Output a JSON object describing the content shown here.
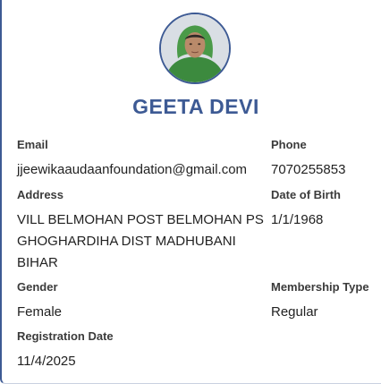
{
  "profile": {
    "name": "GEETA DEVI",
    "avatar_icon": "profile-photo"
  },
  "fields": {
    "email": {
      "label": "Email",
      "value": "jjeewikaaudaanfoundation@gmail.com"
    },
    "phone": {
      "label": "Phone",
      "value": "7070255853"
    },
    "address": {
      "label": "Address",
      "value": "VILL BELMOHAN POST BELMOHAN PS GHOGHARDIHA DIST MADHUBANI BIHAR"
    },
    "dob": {
      "label": "Date of Birth",
      "value": "1/1/1968"
    },
    "gender": {
      "label": "Gender",
      "value": "Female"
    },
    "membership": {
      "label": "Membership Type",
      "value": "Regular"
    },
    "registration": {
      "label": "Registration Date",
      "value": "11/4/2025"
    }
  },
  "colors": {
    "accent": "#3d5a94",
    "label": "#3b3b3b",
    "value": "#222222"
  }
}
